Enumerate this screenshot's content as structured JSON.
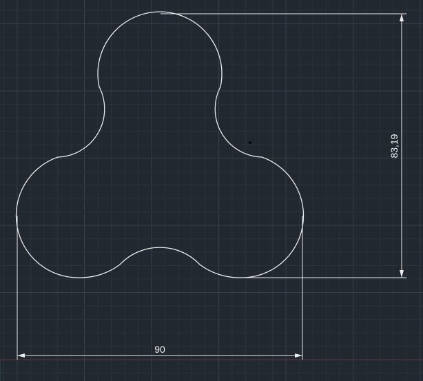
{
  "viewport": {
    "background": "#212830",
    "grid_minor_color": "#2a313a",
    "grid_major_color": "#35404b",
    "geometry_color": "#ececec",
    "axis_x_color": "#6b2f38",
    "axis_y_color": "#2d5a3a"
  },
  "dimensions": {
    "horizontal": {
      "text": "90"
    },
    "vertical": {
      "text": "83,19"
    }
  },
  "cursor_marker": "point"
}
